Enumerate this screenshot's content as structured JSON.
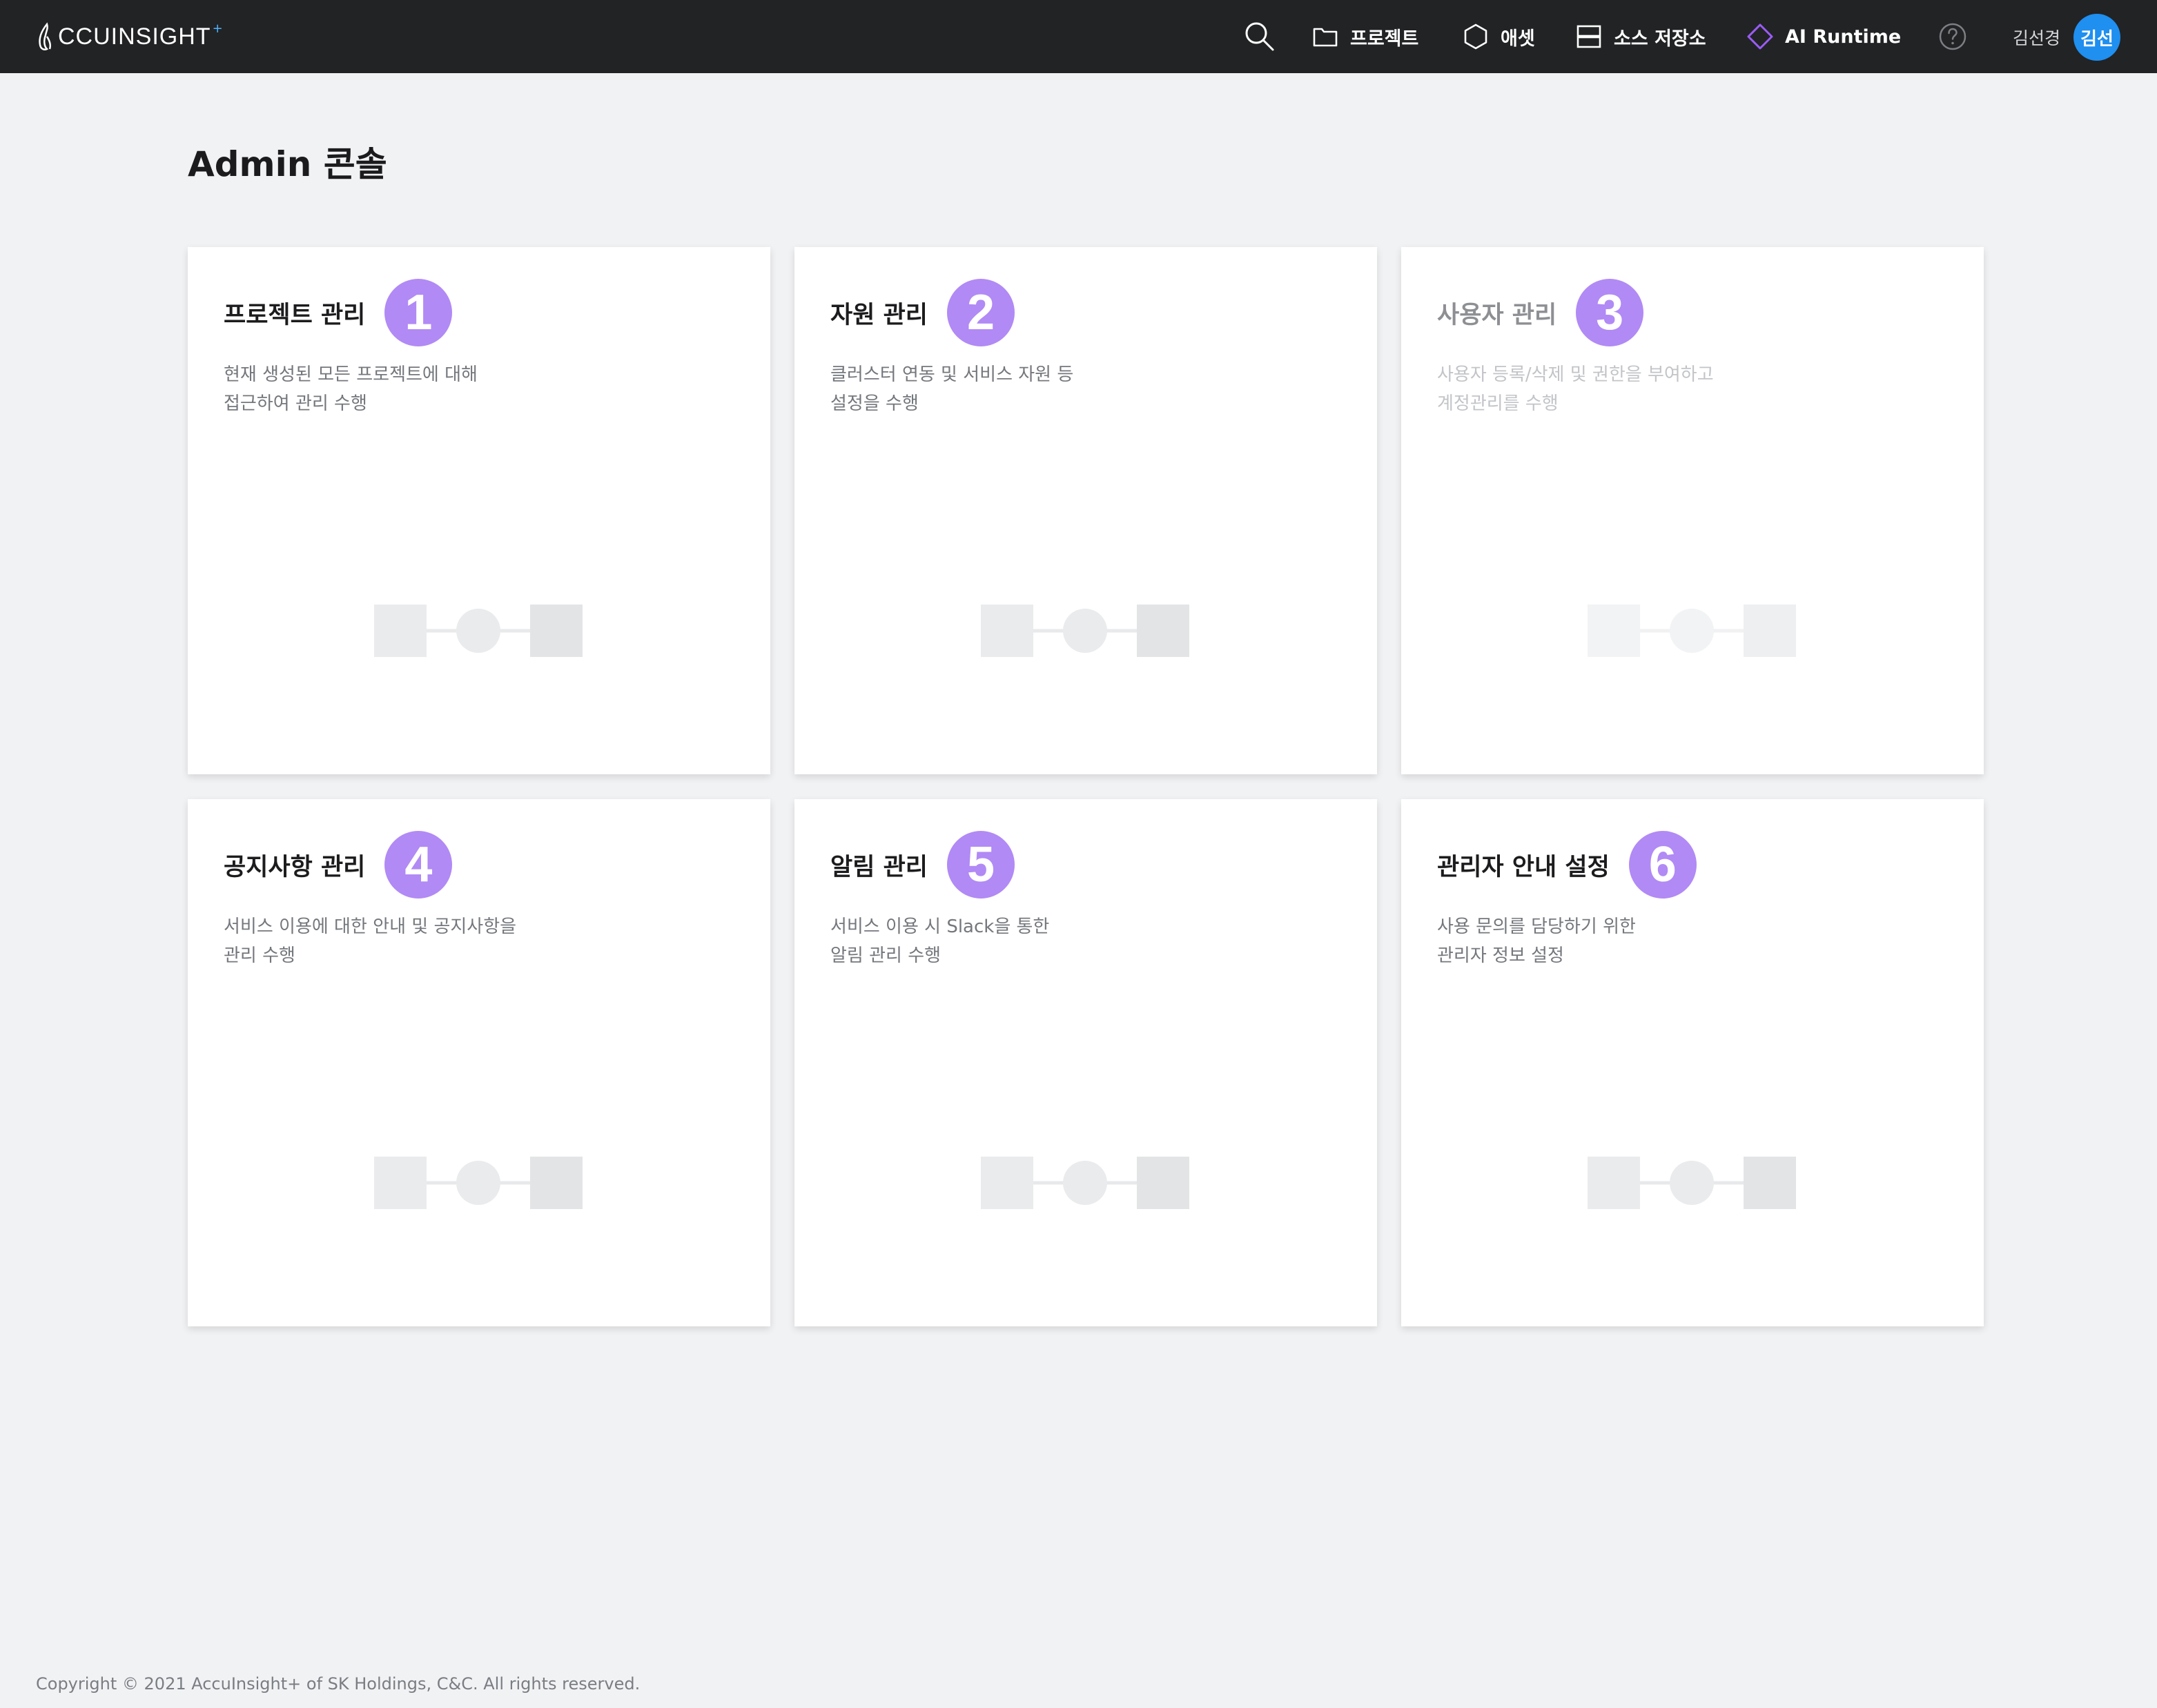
{
  "header": {
    "logo_text": "CCUINSIGHT",
    "logo_plus": "+",
    "nav": {
      "project": "프로젝트",
      "asset": "애셋",
      "source_repo": "소스 저장소",
      "ai_runtime": "AI Runtime"
    },
    "user_name": "김선경",
    "avatar_initials": "김선",
    "icons": [
      "search-icon",
      "folder-icon",
      "hexagon-icon",
      "storage-icon",
      "diamond-icon",
      "help-icon"
    ],
    "colors": {
      "bar": "#222325",
      "avatar": "#1f8ff0",
      "runtime_accent": "#9b5cf6"
    }
  },
  "page": {
    "title": "Admin 콘솔"
  },
  "cards": [
    {
      "title": "프로젝트 관리",
      "number": "1",
      "desc1": "현재 생성된 모든 프로젝트에 대해",
      "desc2": "접근하여 관리 수행",
      "enabled": true
    },
    {
      "title": "자원 관리",
      "number": "2",
      "desc1": "클러스터 연동 및 서비스 자원 등",
      "desc2": "설정을 수행",
      "enabled": true
    },
    {
      "title": "사용자 관리",
      "number": "3",
      "desc1": "사용자 등록/삭제 및 권한을 부여하고",
      "desc2": "계정관리를 수행",
      "enabled": false
    },
    {
      "title": "공지사항 관리",
      "number": "4",
      "desc1": "서비스 이용에 대한 안내 및 공지사항을",
      "desc2": "관리 수행",
      "enabled": true
    },
    {
      "title": "알림 관리",
      "number": "5",
      "desc1": "서비스 이용 시 Slack을 통한",
      "desc2": "알림 관리 수행",
      "enabled": true
    },
    {
      "title": "관리자 안내 설정",
      "number": "6",
      "desc1": "사용 문의를 담당하기 위한",
      "desc2": "관리자 정보 설정",
      "enabled": true
    }
  ],
  "badge_color": "#b18af5",
  "footer": {
    "copyright": "Copyright © 2021 AccuInsight+ of SK Holdings, C&C. All rights reserved."
  }
}
